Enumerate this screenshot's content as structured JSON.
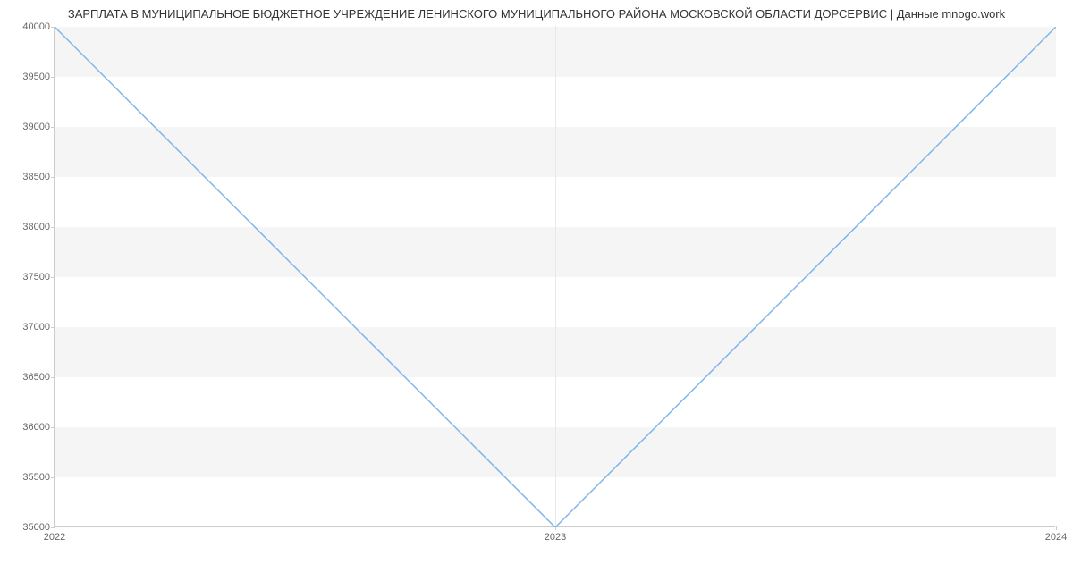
{
  "chart_data": {
    "type": "line",
    "title": "ЗАРПЛАТА В МУНИЦИПАЛЬНОЕ БЮДЖЕТНОЕ УЧРЕЖДЕНИЕ ЛЕНИНСКОГО МУНИЦИПАЛЬНОГО РАЙОНА МОСКОВСКОЙ ОБЛАСТИ ДОРСЕРВИС | Данные mnogo.work",
    "x": [
      "2022",
      "2023",
      "2024"
    ],
    "values": [
      40000,
      35000,
      40000
    ],
    "xlabel": "",
    "ylabel": "",
    "ylim": [
      35000,
      40000
    ],
    "y_ticks": [
      35000,
      35500,
      36000,
      36500,
      37000,
      37500,
      38000,
      38500,
      39000,
      39500,
      40000
    ],
    "x_ticks": [
      "2022",
      "2023",
      "2024"
    ],
    "line_color": "#7cb5ec"
  }
}
